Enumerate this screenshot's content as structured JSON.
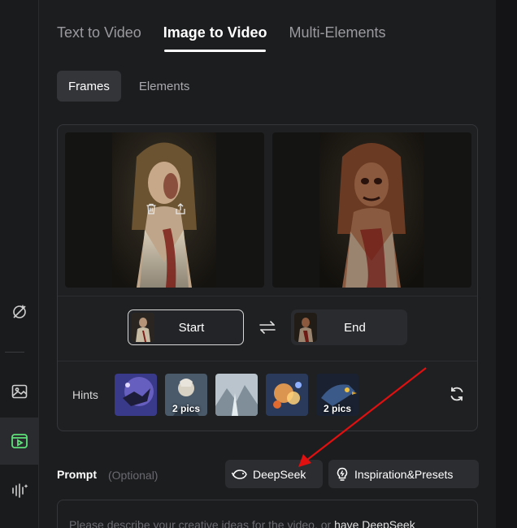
{
  "tabs": [
    {
      "label": "Text to Video",
      "active": false
    },
    {
      "label": "Image to Video",
      "active": true
    },
    {
      "label": "Multi-Elements",
      "active": false
    }
  ],
  "subtabs": [
    {
      "label": "Frames",
      "active": true
    },
    {
      "label": "Elements",
      "active": false
    }
  ],
  "frames": {
    "start_label": "Start",
    "end_label": "End",
    "start_actions": [
      "trash-icon",
      "share-icon"
    ]
  },
  "hints": {
    "label": "Hints",
    "items": [
      {
        "count": ""
      },
      {
        "count": "2 pics"
      },
      {
        "count": ""
      },
      {
        "count": ""
      },
      {
        "count": "2 pics"
      }
    ]
  },
  "prompt": {
    "label": "Prompt",
    "optional": "(Optional)",
    "deepseek_label": "DeepSeek",
    "inspiration_label": "Inspiration&Presets",
    "placeholder_text": "Please describe your creative ideas for the video, or ",
    "placeholder_link": "have DeepSeek"
  },
  "colors": {
    "accent": "#5ee17a",
    "annotation_arrow": "#e01010"
  },
  "rail": {
    "icons": [
      "magic-edit-icon",
      "image-icon",
      "video-icon",
      "audio-icon"
    ],
    "active": "video-icon"
  }
}
